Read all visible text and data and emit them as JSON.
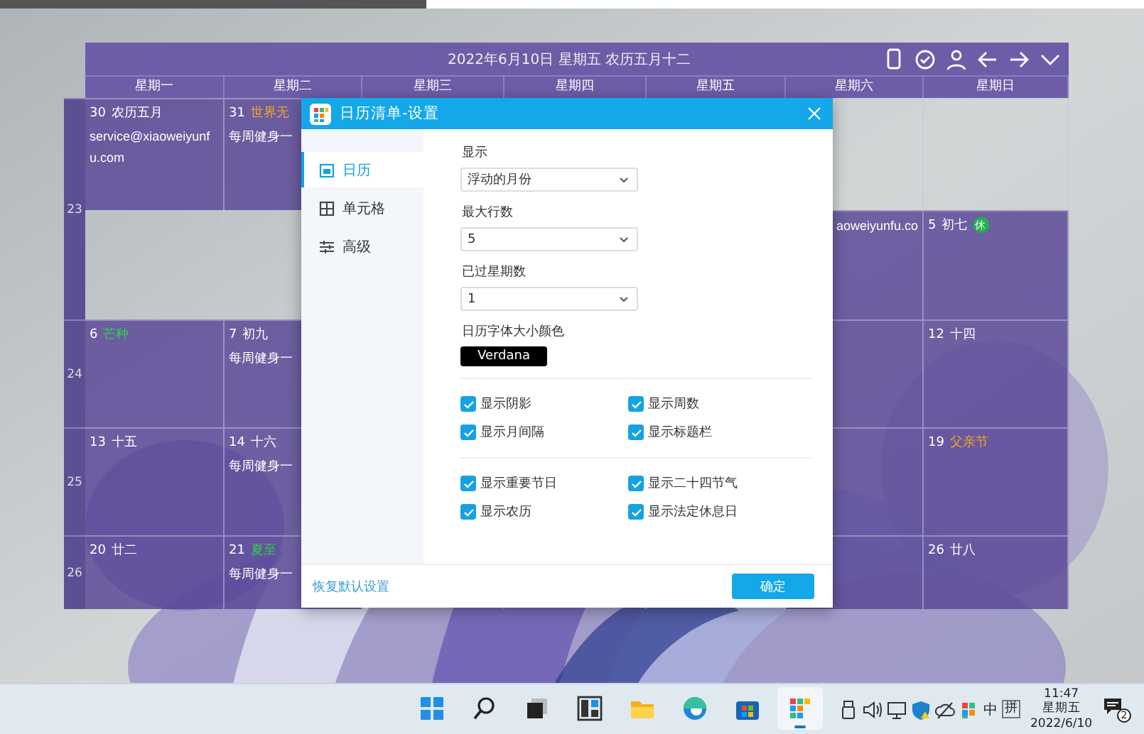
{
  "calendar": {
    "title": "2022年6月10日 星期五 农历五月十二",
    "toolbar": [
      {
        "kind": "phone"
      },
      {
        "kind": "check"
      },
      {
        "kind": "person"
      },
      {
        "kind": "prev"
      },
      {
        "kind": "next"
      },
      {
        "kind": "collapse"
      }
    ],
    "weekdays": [
      "星期一",
      "星期二",
      "星期三",
      "星期四",
      "星期五",
      "星期六",
      "星期日"
    ],
    "weeks": [
      {
        "number": "23",
        "rows": [
          [
            {
              "shaded": true,
              "day": "30",
              "label": {
                "text": "农历五月",
                "color": "#ffffff"
              },
              "notes": [
                "service@xiaoweiyunfu.com"
              ]
            },
            {
              "shaded": true,
              "day": "31",
              "label": {
                "text": "世界无",
                "color": "#f5a623"
              },
              "notes": [
                "每周健身一"
              ]
            },
            {},
            {},
            {},
            {
              "shaded": false
            },
            {
              "shaded": false
            }
          ],
          [
            {
              "shaded": false
            },
            {
              "shaded": false
            },
            {},
            {},
            {},
            {
              "shaded": true,
              "notes": [
                "aoweiyunfu.co"
              ]
            },
            {
              "shaded": true,
              "day": "5",
              "label": {
                "text": "初七",
                "color": "#ffffff"
              },
              "badge": "休"
            }
          ]
        ]
      },
      {
        "number": "24",
        "rows": [
          [
            {
              "shaded": true,
              "day": "6",
              "label": {
                "text": "芒种",
                "color": "#2bd14f"
              }
            },
            {
              "shaded": true,
              "day": "7",
              "label": {
                "text": "初九",
                "color": "#ffffff"
              },
              "notes": [
                "每周健身一"
              ]
            },
            {},
            {},
            {},
            {
              "shaded": true
            },
            {
              "shaded": true,
              "day": "12",
              "label": {
                "text": "十四",
                "color": "#ffffff"
              }
            }
          ]
        ]
      },
      {
        "number": "25",
        "rows": [
          [
            {
              "shaded": true,
              "day": "13",
              "label": {
                "text": "十五",
                "color": "#ffffff"
              }
            },
            {
              "shaded": true,
              "day": "14",
              "label": {
                "text": "十六",
                "color": "#ffffff"
              },
              "notes": [
                "每周健身一"
              ]
            },
            {},
            {},
            {},
            {
              "shaded": true
            },
            {
              "shaded": true,
              "day": "19",
              "label": {
                "text": "父亲节",
                "color": "#f5a623"
              }
            }
          ]
        ]
      },
      {
        "number": "26",
        "rows": [
          [
            {
              "shaded": true,
              "day": "20",
              "label": {
                "text": "廿二",
                "color": "#ffffff"
              }
            },
            {
              "shaded": true,
              "day": "21",
              "label": {
                "text": "夏至",
                "color": "#2bd14f"
              },
              "notes": [
                "每周健身一"
              ]
            },
            {},
            {},
            {},
            {
              "shaded": true
            },
            {
              "shaded": true,
              "day": "26",
              "label": {
                "text": "廿八",
                "color": "#ffffff"
              }
            }
          ]
        ]
      }
    ]
  },
  "dialog": {
    "title": "日历清单-设置",
    "sidebar": [
      {
        "kind": "calendar",
        "label": "日历",
        "selected": true
      },
      {
        "kind": "grid",
        "label": "单元格",
        "selected": false
      },
      {
        "kind": "sliders",
        "label": "高级",
        "selected": false
      }
    ],
    "fields": [
      {
        "kind": "select",
        "label": "显示",
        "value": "浮动的月份"
      },
      {
        "kind": "select",
        "label": "最大行数",
        "value": "5"
      },
      {
        "kind": "select",
        "label": "已过星期数",
        "value": "1"
      },
      {
        "kind": "font",
        "label": "日历字体大小颜色",
        "value": "Verdana"
      }
    ],
    "checkbox_groups": [
      [
        {
          "label": "显示阴影",
          "checked": true
        },
        {
          "label": "显示周数",
          "checked": true
        },
        {
          "label": "显示月间隔",
          "checked": true
        },
        {
          "label": "显示标题栏",
          "checked": true
        }
      ],
      [
        {
          "label": "显示重要节日",
          "checked": true
        },
        {
          "label": "显示二十四节气",
          "checked": true
        },
        {
          "label": "显示农历",
          "checked": true
        },
        {
          "label": "显示法定休息日",
          "checked": true
        }
      ]
    ],
    "reset_link": "恢复默认设置",
    "ok_button": "确定"
  },
  "taskbar": {
    "apps": [
      {
        "kind": "start",
        "active": false
      },
      {
        "kind": "search",
        "active": false
      },
      {
        "kind": "taskview",
        "active": false
      },
      {
        "kind": "widgets",
        "active": false
      },
      {
        "kind": "explorer",
        "active": false
      },
      {
        "kind": "edge",
        "active": false
      },
      {
        "kind": "store",
        "active": false
      },
      {
        "kind": "calendar",
        "active": true
      }
    ],
    "tray": [
      {
        "kind": "usb"
      },
      {
        "kind": "volume"
      },
      {
        "kind": "network"
      },
      {
        "kind": "shield"
      },
      {
        "kind": "cloud"
      },
      {
        "kind": "app"
      }
    ],
    "ime_mode": "中",
    "ime": "拼",
    "time": "11:47",
    "weekday": "星期五",
    "date": "2022/6/10",
    "notifications": "2"
  }
}
